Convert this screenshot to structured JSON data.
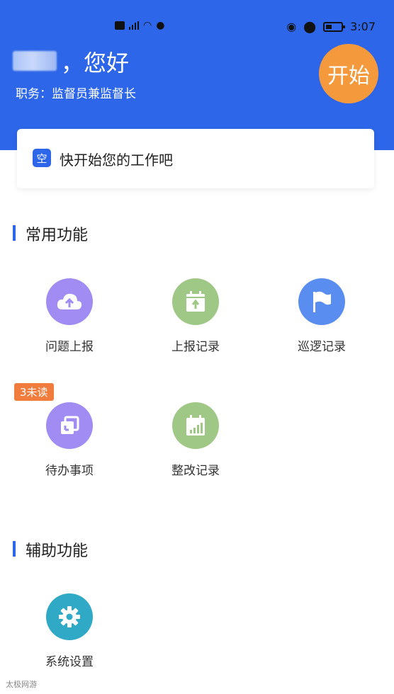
{
  "status_bar": {
    "time": "3:07",
    "left_icons": [
      "signal-icon",
      "wifi-icon",
      "hotspot-icon"
    ],
    "right_icons": [
      "alarm-icon",
      "location-icon",
      "battery-icon"
    ]
  },
  "header": {
    "greeting": "，您好",
    "role": "职务：监督员兼监督长",
    "start_label": "开始",
    "colors": {
      "bg": "#2d66e8",
      "start_button": "#f49a3c"
    }
  },
  "notice": {
    "icon_char": "空",
    "text": "快开始您的工作吧"
  },
  "sections": [
    {
      "title": "常用功能",
      "items": [
        {
          "label": "问题上报",
          "icon": "cloud-upload-icon",
          "color": "#a08cf2"
        },
        {
          "label": "上报记录",
          "icon": "calendar-upload-icon",
          "color": "#9fc785"
        },
        {
          "label": "巡逻记录",
          "icon": "flag-icon",
          "color": "#5a8df0"
        },
        {
          "label": "待办事项",
          "icon": "copy-icon",
          "color": "#a08cf2",
          "badge": "3未读"
        },
        {
          "label": "整改记录",
          "icon": "calendar-chart-icon",
          "color": "#9fc785"
        }
      ]
    },
    {
      "title": "辅助功能",
      "items": [
        {
          "label": "系统设置",
          "icon": "gear-icon",
          "color": "#2fa9c5"
        }
      ]
    }
  ],
  "watermark": "太极网游"
}
